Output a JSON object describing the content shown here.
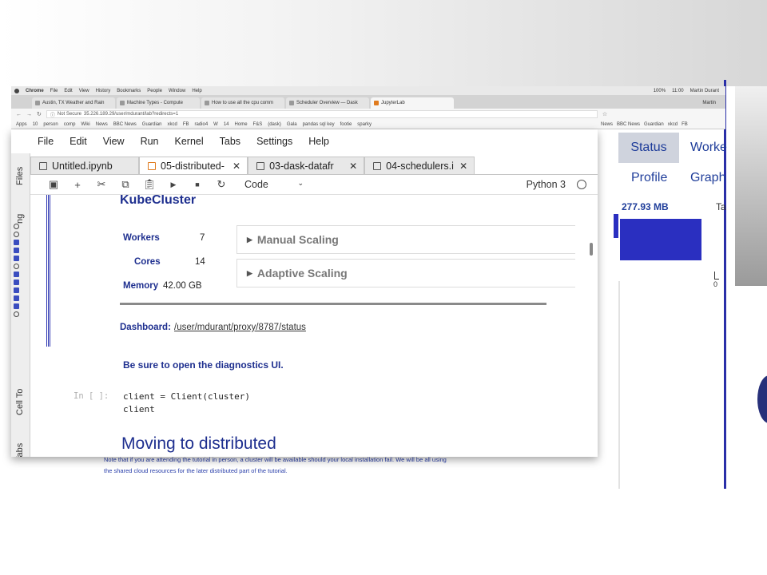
{
  "os_menubar": {
    "app": "Chrome",
    "items": [
      "File",
      "Edit",
      "View",
      "History",
      "Bookmarks",
      "People",
      "Window",
      "Help"
    ],
    "battery": "100%",
    "time": "11:00",
    "user": "Martin Durant"
  },
  "chrome_tabs": [
    {
      "label": "Austin, TX Weather and Rain",
      "active": false
    },
    {
      "label": "Machine Types - Compute",
      "active": false
    },
    {
      "label": "How to use all the cpu comm",
      "active": false
    },
    {
      "label": "Scheduler Overview — Dask",
      "active": false
    },
    {
      "label": "JupyterLab",
      "active": true
    }
  ],
  "chrome_user": "Martin",
  "address_bar": {
    "security": "Not Secure",
    "url": "35.226.189.29/user/mdurant/lab?redirects=1"
  },
  "bookmarks": [
    "Apps",
    "10",
    "person",
    "comp",
    "Wiki",
    "News",
    "BBC News",
    "Guardian",
    "xkcd",
    "FB",
    "radio4",
    "W",
    "14",
    "Home",
    "F&S",
    "(dask)",
    "Gala",
    "pandas sql key",
    "footie",
    "sparky"
  ],
  "dashboard_window": {
    "bookmarks": [
      "News",
      "BBC News",
      "Guardian",
      "xkcd",
      "FB"
    ],
    "nav": {
      "status": "Status",
      "workers": "Worke",
      "profile": "Profile",
      "graph": "Graph"
    },
    "memory": "277.93 MB",
    "tasks_label": "Ta",
    "axis_zero": "0"
  },
  "jupyter": {
    "menu": [
      "File",
      "Edit",
      "View",
      "Run",
      "Kernel",
      "Tabs",
      "Settings",
      "Help"
    ],
    "sidebar": {
      "files": "Files",
      "running": "ng",
      "cell_tools": "Cell To",
      "tabs": "Tabs"
    },
    "tabs": [
      {
        "label": "Untitled.ipynb",
        "active": false
      },
      {
        "label": "05-distributed-",
        "active": true
      },
      {
        "label": "03-dask-datafr",
        "active": false
      },
      {
        "label": "04-schedulers.i",
        "active": false
      }
    ],
    "toolbar": {
      "cell_type": "Code",
      "kernel": "Python 3"
    },
    "notebook": {
      "cluster_title": "KubeCluster",
      "workers_label": "Workers",
      "workers_value": "7",
      "cores_label": "Cores",
      "cores_value": "14",
      "memory_label": "Memory",
      "memory_value": "42.00 GB",
      "manual_scaling": "Manual Scaling",
      "adaptive_scaling": "Adaptive Scaling",
      "dashboard_label": "Dashboard:",
      "dashboard_link": "/user/mdurant/proxy/8787/status",
      "diagnostics_note": "Be sure to open the diagnostics UI.",
      "prompt": "In [ ]:",
      "code": "client = Client(cluster)\nclient",
      "section_heading": "Moving to distributed"
    }
  },
  "below_window": {
    "line1": "Note that if you are attending the tutorial in person, a cluster will be available should your local installation fail. We will be all using",
    "line2": "the shared cloud resources for the later distributed part of the tutorial."
  }
}
